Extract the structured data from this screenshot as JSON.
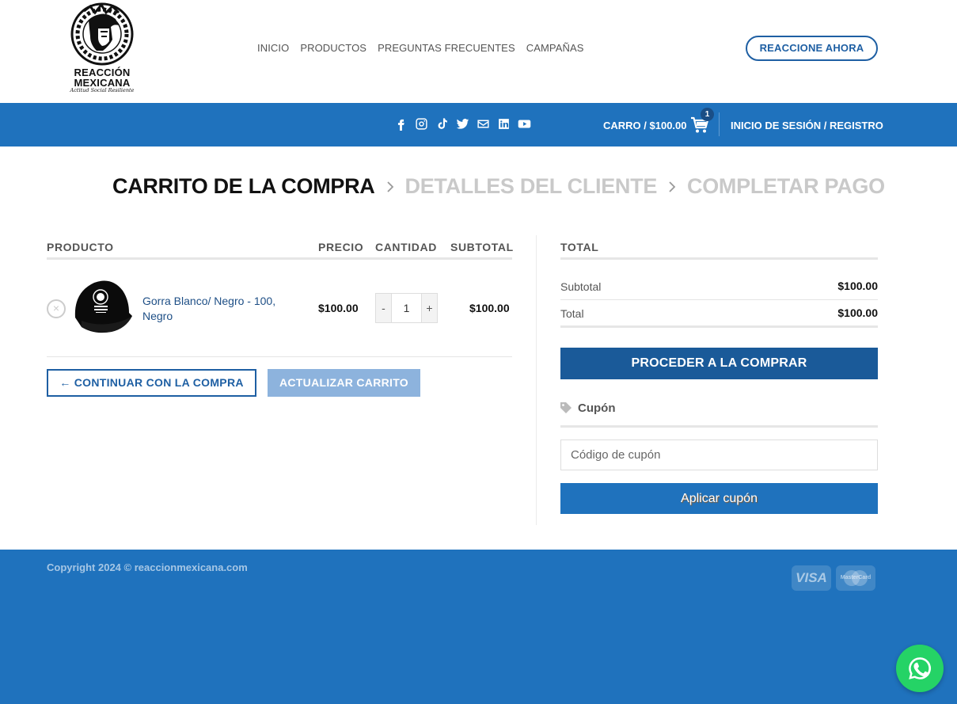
{
  "brand": {
    "line1": "REACCIÓN",
    "line2": "MEXICANA",
    "tagline": "Actitud Social Resiliente"
  },
  "nav": {
    "items": [
      "INICIO",
      "PRODUCTOS",
      "PREGUNTAS FRECUENTES",
      "CAMPAÑAS"
    ],
    "cta": "REACCIONE AHORA"
  },
  "topbar": {
    "socials": [
      "facebook-icon",
      "instagram-icon",
      "tiktok-icon",
      "twitter-icon",
      "email-icon",
      "linkedin-icon",
      "youtube-icon"
    ],
    "cart_label": "CARRO / $100.00",
    "cart_count": "1",
    "login": "INICIO DE SESIÓN / REGISTRO"
  },
  "breadcrumb": {
    "step1": "CARRITO DE LA COMPRA",
    "step2": "DETALLES DEL CLIENTE",
    "step3": "COMPLETAR PAGO"
  },
  "cart": {
    "headers": {
      "product": "PRODUCTO",
      "price": "PRECIO",
      "quantity": "CANTIDAD",
      "subtotal": "SUBTOTAL"
    },
    "items": [
      {
        "remove": "×",
        "name": "Gorra Blanco/ Negro - 100, Negro",
        "price": "$100.00",
        "quantity": "1",
        "subtotal": "$100.00"
      }
    ],
    "qty_minus": "-",
    "qty_plus": "+",
    "continue_label": "← CONTINUAR CON LA COMPRA",
    "update_label": "ACTUALIZAR CARRITO"
  },
  "totals": {
    "header": "TOTAL",
    "subtotal_label": "Subtotal",
    "subtotal_value": "$100.00",
    "total_label": "Total",
    "total_value": "$100.00",
    "checkout_label": "PROCEDER A LA COMPRAR",
    "coupon_label": "Cupón",
    "coupon_placeholder": "Código de cupón",
    "apply_label": "Aplicar cupón"
  },
  "footer": {
    "copyright": "Copyright 2024 © reaccionmexicana.com",
    "payment_cards": [
      "VISA",
      "MasterCard"
    ]
  },
  "colors": {
    "primary": "#1f72bd",
    "dark_primary": "#1a5a99",
    "whatsapp": "#25d366"
  }
}
